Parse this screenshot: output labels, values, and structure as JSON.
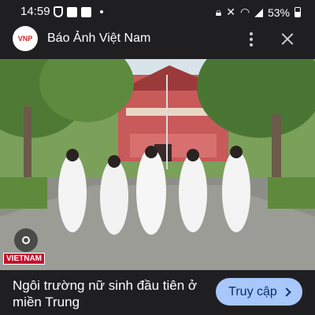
{
  "status_bar": {
    "time": "14:59",
    "battery": "53%"
  },
  "header": {
    "logo_text": "VNP",
    "site_name": "Báo Ảnh Việt Nam"
  },
  "image": {
    "watermark": "VIETNAM"
  },
  "footer": {
    "caption": "Ngôi trường nữ sinh đầu tiên ở miền Trung",
    "visit_label": "Truy cập"
  },
  "colors": {
    "accent_button": "#a8c7fa",
    "background": "#1f1f22",
    "brand_red": "#d22"
  }
}
